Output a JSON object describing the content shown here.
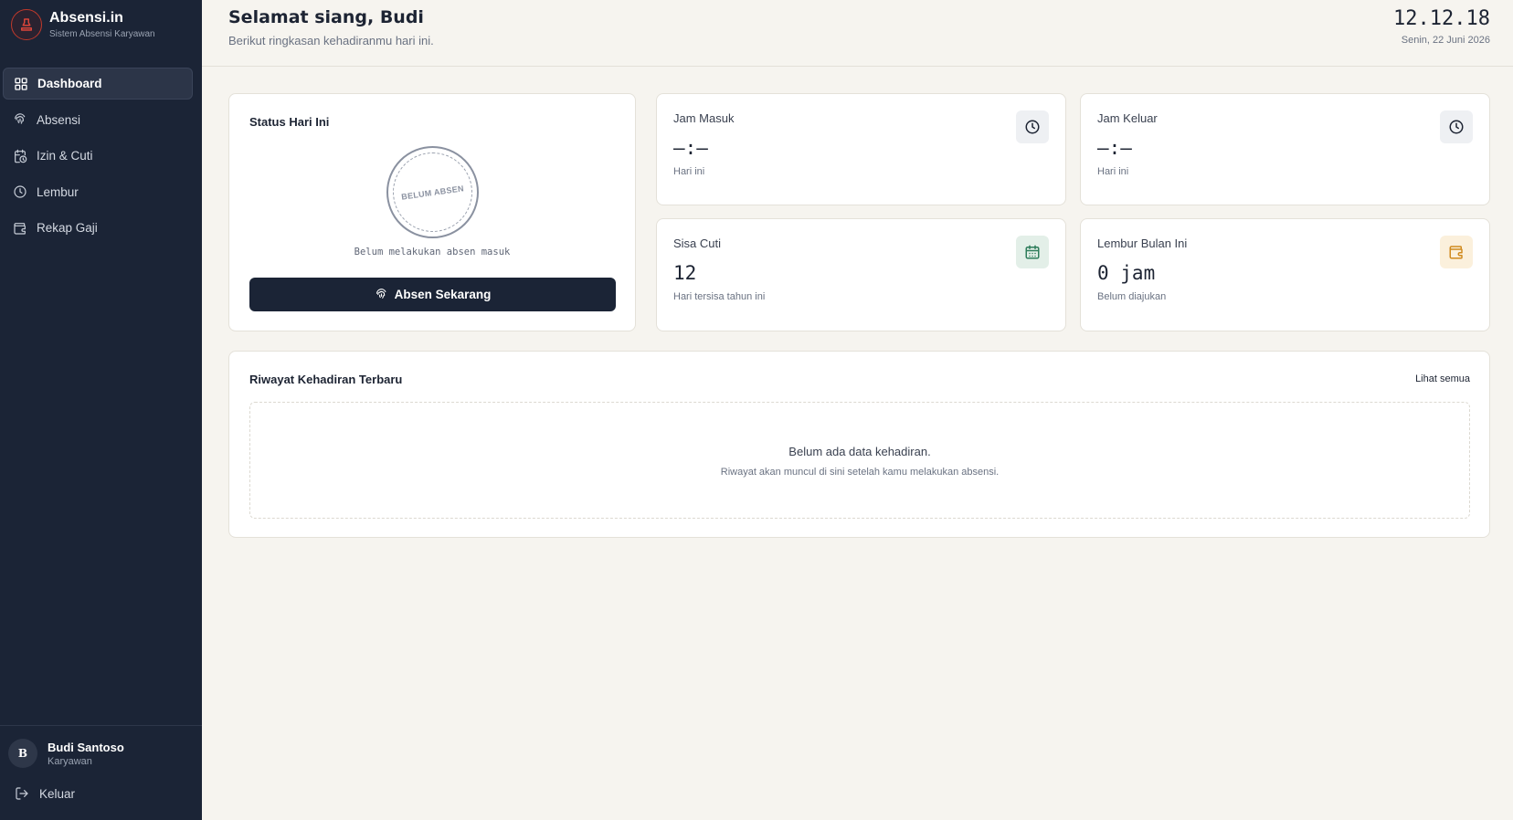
{
  "brand": {
    "name": "Absensi.in",
    "tagline": "Sistem Absensi Karyawan"
  },
  "sidebar": {
    "items": [
      {
        "label": "Dashboard",
        "icon": "grid-icon",
        "active": true
      },
      {
        "label": "Absensi",
        "icon": "fingerprint-icon"
      },
      {
        "label": "Izin & Cuti",
        "icon": "calendar-clock-icon"
      },
      {
        "label": "Lembur",
        "icon": "clock-icon"
      },
      {
        "label": "Rekap Gaji",
        "icon": "wallet-icon"
      }
    ],
    "user": {
      "initial": "B",
      "name": "Budi Santoso",
      "role": "Karyawan"
    },
    "logout_label": "Keluar"
  },
  "header": {
    "greeting": "Selamat siang, Budi",
    "subtitle": "Berikut ringkasan kehadiranmu hari ini.",
    "time": "12.12.18",
    "date": "Senin, 22 Juni 2026"
  },
  "status": {
    "title": "Status Hari Ini",
    "stamp": "BELUM ABSEN",
    "note": "Belum melakukan absen masuk",
    "button": "Absen Sekarang"
  },
  "stats": {
    "jam_masuk": {
      "label": "Jam Masuk",
      "value": "—:—",
      "sub": "Hari ini",
      "icon": "clock-icon"
    },
    "jam_keluar": {
      "label": "Jam Keluar",
      "value": "—:—",
      "sub": "Hari ini",
      "icon": "clock-icon"
    },
    "sisa_cuti": {
      "label": "Sisa Cuti",
      "value": "12",
      "sub": "Hari tersisa tahun ini",
      "icon": "calendar-icon"
    },
    "lembur": {
      "label": "Lembur Bulan Ini",
      "value": "0 jam",
      "sub": "Belum diajukan",
      "icon": "wallet-icon"
    }
  },
  "history": {
    "title": "Riwayat Kehadiran Terbaru",
    "see_all": "Lihat semua",
    "empty_title": "Belum ada data kehadiran.",
    "empty_sub": "Riwayat akan muncul di sini setelah kamu melakukan absensi."
  },
  "colors": {
    "sidebar_bg": "#1b2436",
    "page_bg": "#f6f4ef",
    "brand_accent": "#c0392b",
    "green_accent": "#2e7d5b",
    "amber_accent": "#d08a1e"
  }
}
